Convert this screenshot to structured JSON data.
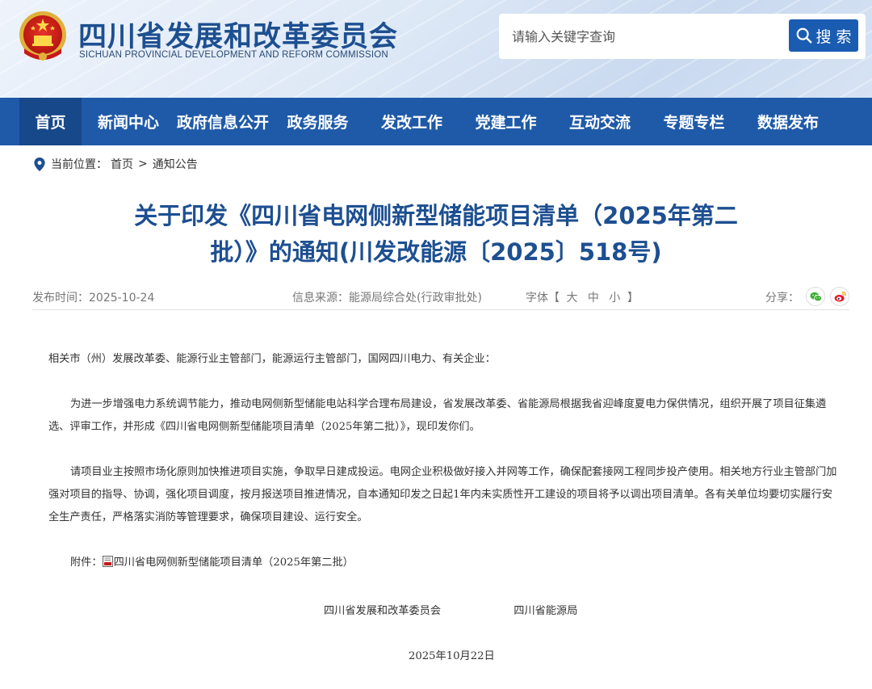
{
  "header": {
    "title": "四川省发展和改革委员会",
    "subtitle": "SICHUAN PROVINCIAL DEVELOPMENT AND REFORM COMMISSION",
    "search_placeholder": "请输入关键字查询",
    "search_label": "搜 索"
  },
  "nav": {
    "items": [
      "首页",
      "新闻中心",
      "政府信息公开",
      "政务服务",
      "发改工作",
      "党建工作",
      "互动交流",
      "专题专栏",
      "数据发布"
    ],
    "active_index": 0
  },
  "breadcrumb": {
    "label": "当前位置：",
    "home": "首页",
    "separator": ">",
    "current": "通知公告"
  },
  "article": {
    "title_line1": "关于印发《四川省电网侧新型储能项目清单（2025年第二",
    "title_line2": "批）》的通知(川发改能源〔2025〕518号)",
    "published": "发布时间：2025-10-24",
    "source": "信息来源：能源局综合处(行政审批处)",
    "font_label_open": "字体【",
    "font_large": "大",
    "font_medium": "中",
    "font_small": "小",
    "font_label_close": "】",
    "share_label": "分享：",
    "salutation": "相关市（州）发展改革委、能源行业主管部门，能源运行主管部门，国网四川电力、有关企业：",
    "para1": "为进一步增强电力系统调节能力，推动电网侧新型储能电站科学合理布局建设，省发展改革委、省能源局根据我省迎峰度夏电力保供情况，组织开展了项目征集遴选、评审工作，并形成《四川省电网侧新型储能项目清单（2025年第二批）》，现印发你们。",
    "para2": "请项目业主按照市场化原则加快推进项目实施，争取早日建成投运。电网企业积极做好接入并网等工作，确保配套接网工程同步投产使用。相关地方行业主管部门加强对项目的指导、协调，强化项目调度，按月报送项目推进情况，自本通知印发之日起1年内未实质性开工建设的项目将予以调出项目清单。各有关单位均要切实履行安全生产责任，严格落实消防等管理要求，确保项目建设、运行安全。",
    "attachment_label": "附件：",
    "attachment_name": "四川省电网侧新型储能项目清单（2025年第二批）",
    "signer1": "四川省发展和改革委员会",
    "signer2": "四川省能源局",
    "sign_date": "2025年10月22日"
  },
  "colors": {
    "brand_blue": "#1d4f91",
    "nav_bg": "#1f5aa8",
    "nav_active": "#17488a",
    "search_button": "#1a5cb1",
    "wechat_green": "#3cb034",
    "weibo_red": "#e6162d"
  }
}
